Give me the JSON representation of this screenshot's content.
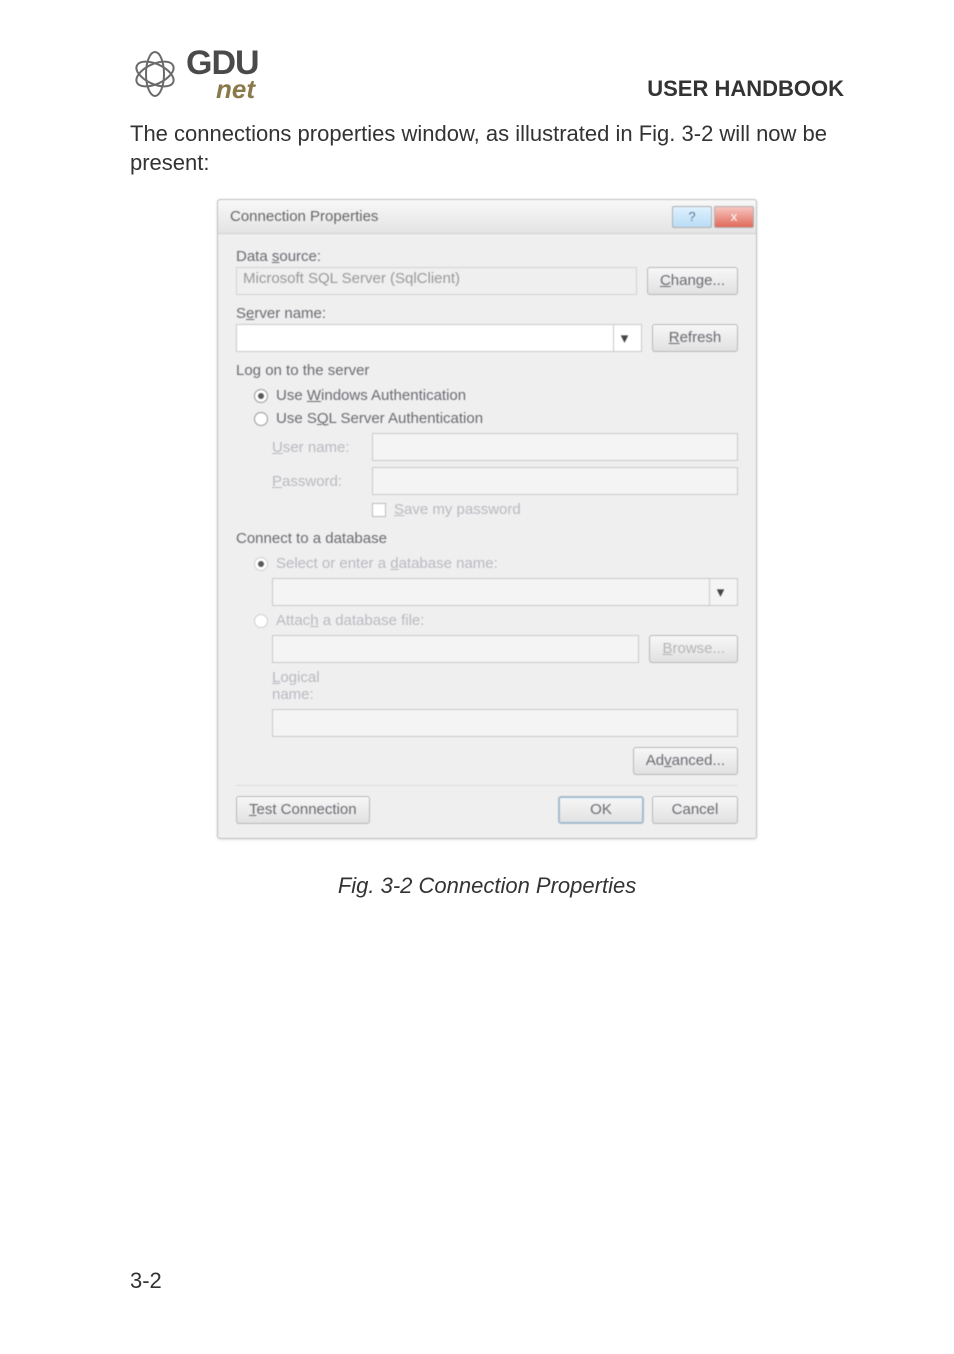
{
  "header": {
    "logo_gdu": "GDU",
    "logo_net": "net",
    "title": "USER HANDBOOK"
  },
  "intro": "The connections properties window, as illustrated in Fig. 3-2 will now be present:",
  "dialog": {
    "title": "Connection Properties",
    "help_glyph": "?",
    "close_glyph": "x",
    "data_source_label": "Data source:",
    "data_source_value": "Microsoft SQL Server (SqlClient)",
    "change_btn": "Change...",
    "server_name_label": "Server name:",
    "server_name_value": "",
    "refresh_btn": "Refresh",
    "logon_title": "Log on to the server",
    "auth_win": "Use Windows Authentication",
    "auth_sql": "Use SQL Server Authentication",
    "user_label": "User name:",
    "pass_label": "Password:",
    "save_pw": "Save my password",
    "connect_title": "Connect to a database",
    "db_select": "Select or enter a database name:",
    "db_attach": "Attach a database file:",
    "browse_btn": "Browse...",
    "logical_label": "Logical name:",
    "advanced_btn": "Advanced...",
    "test_btn": "Test Connection",
    "ok_btn": "OK",
    "cancel_btn": "Cancel"
  },
  "caption": "Fig. 3-2  Connection Properties",
  "page_number": "3-2"
}
